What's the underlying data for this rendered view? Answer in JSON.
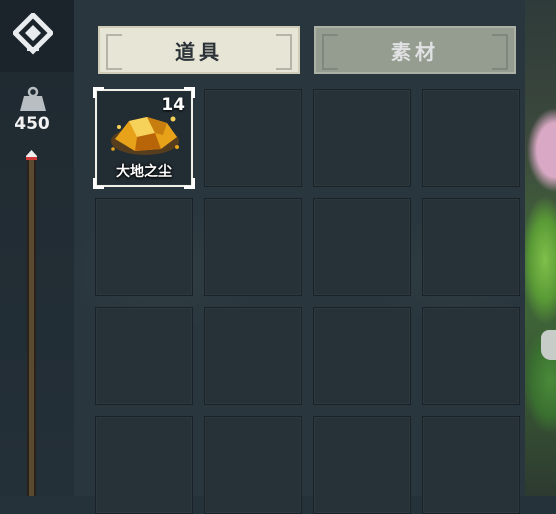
{
  "sidebar": {
    "logo_icon": "diamond-arrow-logo",
    "weight_icon": "weight-icon",
    "capacity": "450",
    "capacity_fill": 0.0
  },
  "tabs": [
    {
      "label": "道具",
      "active": true
    },
    {
      "label": "素材",
      "active": false
    }
  ],
  "inventory": {
    "slots": [
      {
        "name": "大地之尘",
        "quantity": "14",
        "icon": "golden-dust-icon",
        "selected": true
      },
      {},
      {},
      {},
      {},
      {},
      {},
      {},
      {},
      {},
      {},
      {},
      {},
      {},
      {},
      {}
    ]
  },
  "colors": {
    "tab_active_bg": "#e7e6d6",
    "tab_inactive_bg": "#a8b0a0",
    "slot_bg": "#263138",
    "item_gold": "#e8a21a"
  }
}
